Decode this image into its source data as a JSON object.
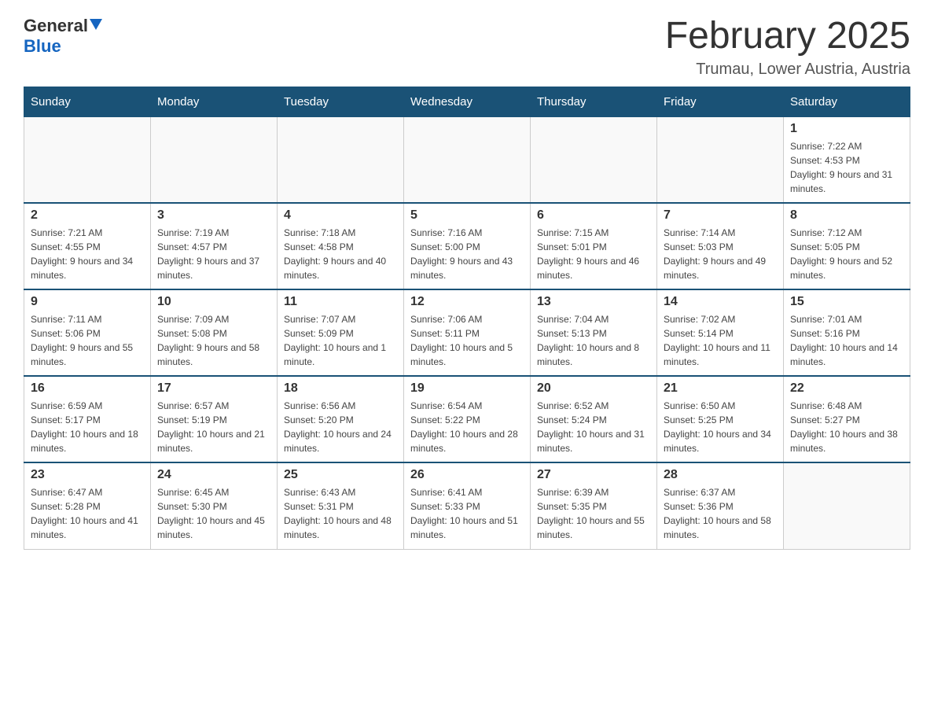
{
  "header": {
    "logo_general": "General",
    "logo_blue": "Blue",
    "month_title": "February 2025",
    "location": "Trumau, Lower Austria, Austria"
  },
  "days_of_week": [
    "Sunday",
    "Monday",
    "Tuesday",
    "Wednesday",
    "Thursday",
    "Friday",
    "Saturday"
  ],
  "weeks": [
    [
      {
        "day": "",
        "info": ""
      },
      {
        "day": "",
        "info": ""
      },
      {
        "day": "",
        "info": ""
      },
      {
        "day": "",
        "info": ""
      },
      {
        "day": "",
        "info": ""
      },
      {
        "day": "",
        "info": ""
      },
      {
        "day": "1",
        "info": "Sunrise: 7:22 AM\nSunset: 4:53 PM\nDaylight: 9 hours and 31 minutes."
      }
    ],
    [
      {
        "day": "2",
        "info": "Sunrise: 7:21 AM\nSunset: 4:55 PM\nDaylight: 9 hours and 34 minutes."
      },
      {
        "day": "3",
        "info": "Sunrise: 7:19 AM\nSunset: 4:57 PM\nDaylight: 9 hours and 37 minutes."
      },
      {
        "day": "4",
        "info": "Sunrise: 7:18 AM\nSunset: 4:58 PM\nDaylight: 9 hours and 40 minutes."
      },
      {
        "day": "5",
        "info": "Sunrise: 7:16 AM\nSunset: 5:00 PM\nDaylight: 9 hours and 43 minutes."
      },
      {
        "day": "6",
        "info": "Sunrise: 7:15 AM\nSunset: 5:01 PM\nDaylight: 9 hours and 46 minutes."
      },
      {
        "day": "7",
        "info": "Sunrise: 7:14 AM\nSunset: 5:03 PM\nDaylight: 9 hours and 49 minutes."
      },
      {
        "day": "8",
        "info": "Sunrise: 7:12 AM\nSunset: 5:05 PM\nDaylight: 9 hours and 52 minutes."
      }
    ],
    [
      {
        "day": "9",
        "info": "Sunrise: 7:11 AM\nSunset: 5:06 PM\nDaylight: 9 hours and 55 minutes."
      },
      {
        "day": "10",
        "info": "Sunrise: 7:09 AM\nSunset: 5:08 PM\nDaylight: 9 hours and 58 minutes."
      },
      {
        "day": "11",
        "info": "Sunrise: 7:07 AM\nSunset: 5:09 PM\nDaylight: 10 hours and 1 minute."
      },
      {
        "day": "12",
        "info": "Sunrise: 7:06 AM\nSunset: 5:11 PM\nDaylight: 10 hours and 5 minutes."
      },
      {
        "day": "13",
        "info": "Sunrise: 7:04 AM\nSunset: 5:13 PM\nDaylight: 10 hours and 8 minutes."
      },
      {
        "day": "14",
        "info": "Sunrise: 7:02 AM\nSunset: 5:14 PM\nDaylight: 10 hours and 11 minutes."
      },
      {
        "day": "15",
        "info": "Sunrise: 7:01 AM\nSunset: 5:16 PM\nDaylight: 10 hours and 14 minutes."
      }
    ],
    [
      {
        "day": "16",
        "info": "Sunrise: 6:59 AM\nSunset: 5:17 PM\nDaylight: 10 hours and 18 minutes."
      },
      {
        "day": "17",
        "info": "Sunrise: 6:57 AM\nSunset: 5:19 PM\nDaylight: 10 hours and 21 minutes."
      },
      {
        "day": "18",
        "info": "Sunrise: 6:56 AM\nSunset: 5:20 PM\nDaylight: 10 hours and 24 minutes."
      },
      {
        "day": "19",
        "info": "Sunrise: 6:54 AM\nSunset: 5:22 PM\nDaylight: 10 hours and 28 minutes."
      },
      {
        "day": "20",
        "info": "Sunrise: 6:52 AM\nSunset: 5:24 PM\nDaylight: 10 hours and 31 minutes."
      },
      {
        "day": "21",
        "info": "Sunrise: 6:50 AM\nSunset: 5:25 PM\nDaylight: 10 hours and 34 minutes."
      },
      {
        "day": "22",
        "info": "Sunrise: 6:48 AM\nSunset: 5:27 PM\nDaylight: 10 hours and 38 minutes."
      }
    ],
    [
      {
        "day": "23",
        "info": "Sunrise: 6:47 AM\nSunset: 5:28 PM\nDaylight: 10 hours and 41 minutes."
      },
      {
        "day": "24",
        "info": "Sunrise: 6:45 AM\nSunset: 5:30 PM\nDaylight: 10 hours and 45 minutes."
      },
      {
        "day": "25",
        "info": "Sunrise: 6:43 AM\nSunset: 5:31 PM\nDaylight: 10 hours and 48 minutes."
      },
      {
        "day": "26",
        "info": "Sunrise: 6:41 AM\nSunset: 5:33 PM\nDaylight: 10 hours and 51 minutes."
      },
      {
        "day": "27",
        "info": "Sunrise: 6:39 AM\nSunset: 5:35 PM\nDaylight: 10 hours and 55 minutes."
      },
      {
        "day": "28",
        "info": "Sunrise: 6:37 AM\nSunset: 5:36 PM\nDaylight: 10 hours and 58 minutes."
      },
      {
        "day": "",
        "info": ""
      }
    ]
  ]
}
